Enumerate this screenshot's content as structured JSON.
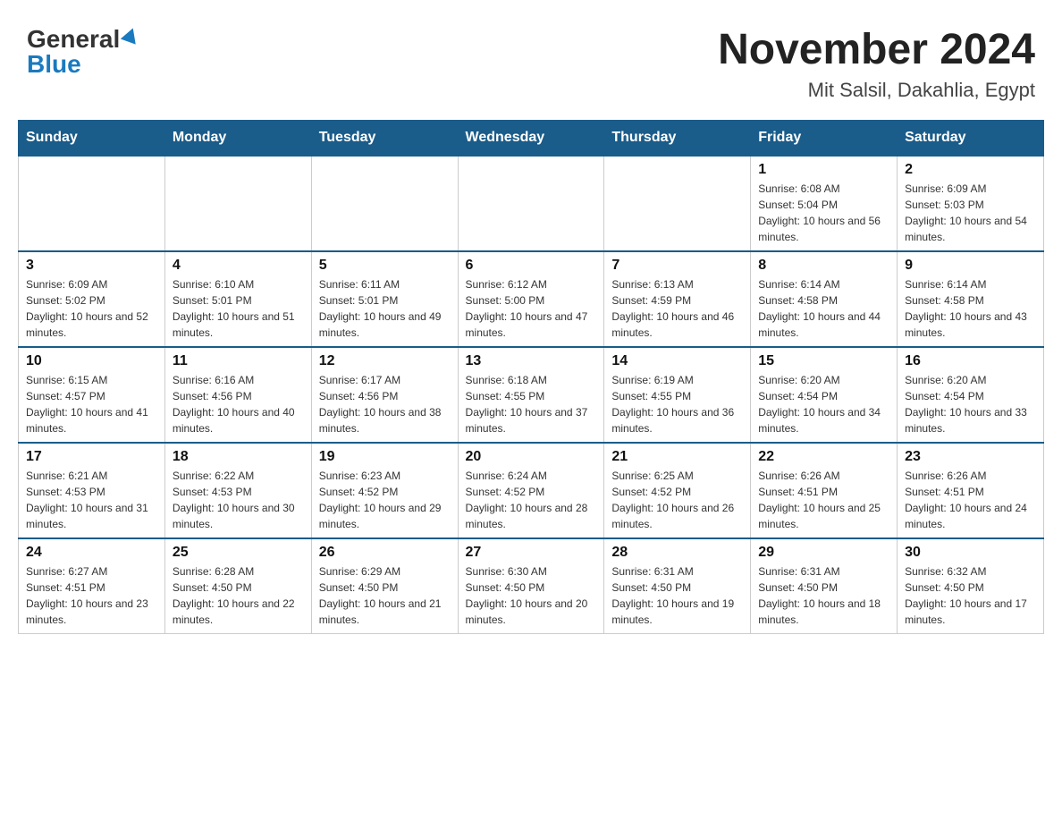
{
  "header": {
    "logo_general": "General",
    "logo_blue": "Blue",
    "month_title": "November 2024",
    "location": "Mit Salsil, Dakahlia, Egypt"
  },
  "weekdays": [
    "Sunday",
    "Monday",
    "Tuesday",
    "Wednesday",
    "Thursday",
    "Friday",
    "Saturday"
  ],
  "weeks": [
    [
      {
        "day": "",
        "info": ""
      },
      {
        "day": "",
        "info": ""
      },
      {
        "day": "",
        "info": ""
      },
      {
        "day": "",
        "info": ""
      },
      {
        "day": "",
        "info": ""
      },
      {
        "day": "1",
        "info": "Sunrise: 6:08 AM\nSunset: 5:04 PM\nDaylight: 10 hours and 56 minutes."
      },
      {
        "day": "2",
        "info": "Sunrise: 6:09 AM\nSunset: 5:03 PM\nDaylight: 10 hours and 54 minutes."
      }
    ],
    [
      {
        "day": "3",
        "info": "Sunrise: 6:09 AM\nSunset: 5:02 PM\nDaylight: 10 hours and 52 minutes."
      },
      {
        "day": "4",
        "info": "Sunrise: 6:10 AM\nSunset: 5:01 PM\nDaylight: 10 hours and 51 minutes."
      },
      {
        "day": "5",
        "info": "Sunrise: 6:11 AM\nSunset: 5:01 PM\nDaylight: 10 hours and 49 minutes."
      },
      {
        "day": "6",
        "info": "Sunrise: 6:12 AM\nSunset: 5:00 PM\nDaylight: 10 hours and 47 minutes."
      },
      {
        "day": "7",
        "info": "Sunrise: 6:13 AM\nSunset: 4:59 PM\nDaylight: 10 hours and 46 minutes."
      },
      {
        "day": "8",
        "info": "Sunrise: 6:14 AM\nSunset: 4:58 PM\nDaylight: 10 hours and 44 minutes."
      },
      {
        "day": "9",
        "info": "Sunrise: 6:14 AM\nSunset: 4:58 PM\nDaylight: 10 hours and 43 minutes."
      }
    ],
    [
      {
        "day": "10",
        "info": "Sunrise: 6:15 AM\nSunset: 4:57 PM\nDaylight: 10 hours and 41 minutes."
      },
      {
        "day": "11",
        "info": "Sunrise: 6:16 AM\nSunset: 4:56 PM\nDaylight: 10 hours and 40 minutes."
      },
      {
        "day": "12",
        "info": "Sunrise: 6:17 AM\nSunset: 4:56 PM\nDaylight: 10 hours and 38 minutes."
      },
      {
        "day": "13",
        "info": "Sunrise: 6:18 AM\nSunset: 4:55 PM\nDaylight: 10 hours and 37 minutes."
      },
      {
        "day": "14",
        "info": "Sunrise: 6:19 AM\nSunset: 4:55 PM\nDaylight: 10 hours and 36 minutes."
      },
      {
        "day": "15",
        "info": "Sunrise: 6:20 AM\nSunset: 4:54 PM\nDaylight: 10 hours and 34 minutes."
      },
      {
        "day": "16",
        "info": "Sunrise: 6:20 AM\nSunset: 4:54 PM\nDaylight: 10 hours and 33 minutes."
      }
    ],
    [
      {
        "day": "17",
        "info": "Sunrise: 6:21 AM\nSunset: 4:53 PM\nDaylight: 10 hours and 31 minutes."
      },
      {
        "day": "18",
        "info": "Sunrise: 6:22 AM\nSunset: 4:53 PM\nDaylight: 10 hours and 30 minutes."
      },
      {
        "day": "19",
        "info": "Sunrise: 6:23 AM\nSunset: 4:52 PM\nDaylight: 10 hours and 29 minutes."
      },
      {
        "day": "20",
        "info": "Sunrise: 6:24 AM\nSunset: 4:52 PM\nDaylight: 10 hours and 28 minutes."
      },
      {
        "day": "21",
        "info": "Sunrise: 6:25 AM\nSunset: 4:52 PM\nDaylight: 10 hours and 26 minutes."
      },
      {
        "day": "22",
        "info": "Sunrise: 6:26 AM\nSunset: 4:51 PM\nDaylight: 10 hours and 25 minutes."
      },
      {
        "day": "23",
        "info": "Sunrise: 6:26 AM\nSunset: 4:51 PM\nDaylight: 10 hours and 24 minutes."
      }
    ],
    [
      {
        "day": "24",
        "info": "Sunrise: 6:27 AM\nSunset: 4:51 PM\nDaylight: 10 hours and 23 minutes."
      },
      {
        "day": "25",
        "info": "Sunrise: 6:28 AM\nSunset: 4:50 PM\nDaylight: 10 hours and 22 minutes."
      },
      {
        "day": "26",
        "info": "Sunrise: 6:29 AM\nSunset: 4:50 PM\nDaylight: 10 hours and 21 minutes."
      },
      {
        "day": "27",
        "info": "Sunrise: 6:30 AM\nSunset: 4:50 PM\nDaylight: 10 hours and 20 minutes."
      },
      {
        "day": "28",
        "info": "Sunrise: 6:31 AM\nSunset: 4:50 PM\nDaylight: 10 hours and 19 minutes."
      },
      {
        "day": "29",
        "info": "Sunrise: 6:31 AM\nSunset: 4:50 PM\nDaylight: 10 hours and 18 minutes."
      },
      {
        "day": "30",
        "info": "Sunrise: 6:32 AM\nSunset: 4:50 PM\nDaylight: 10 hours and 17 minutes."
      }
    ]
  ]
}
